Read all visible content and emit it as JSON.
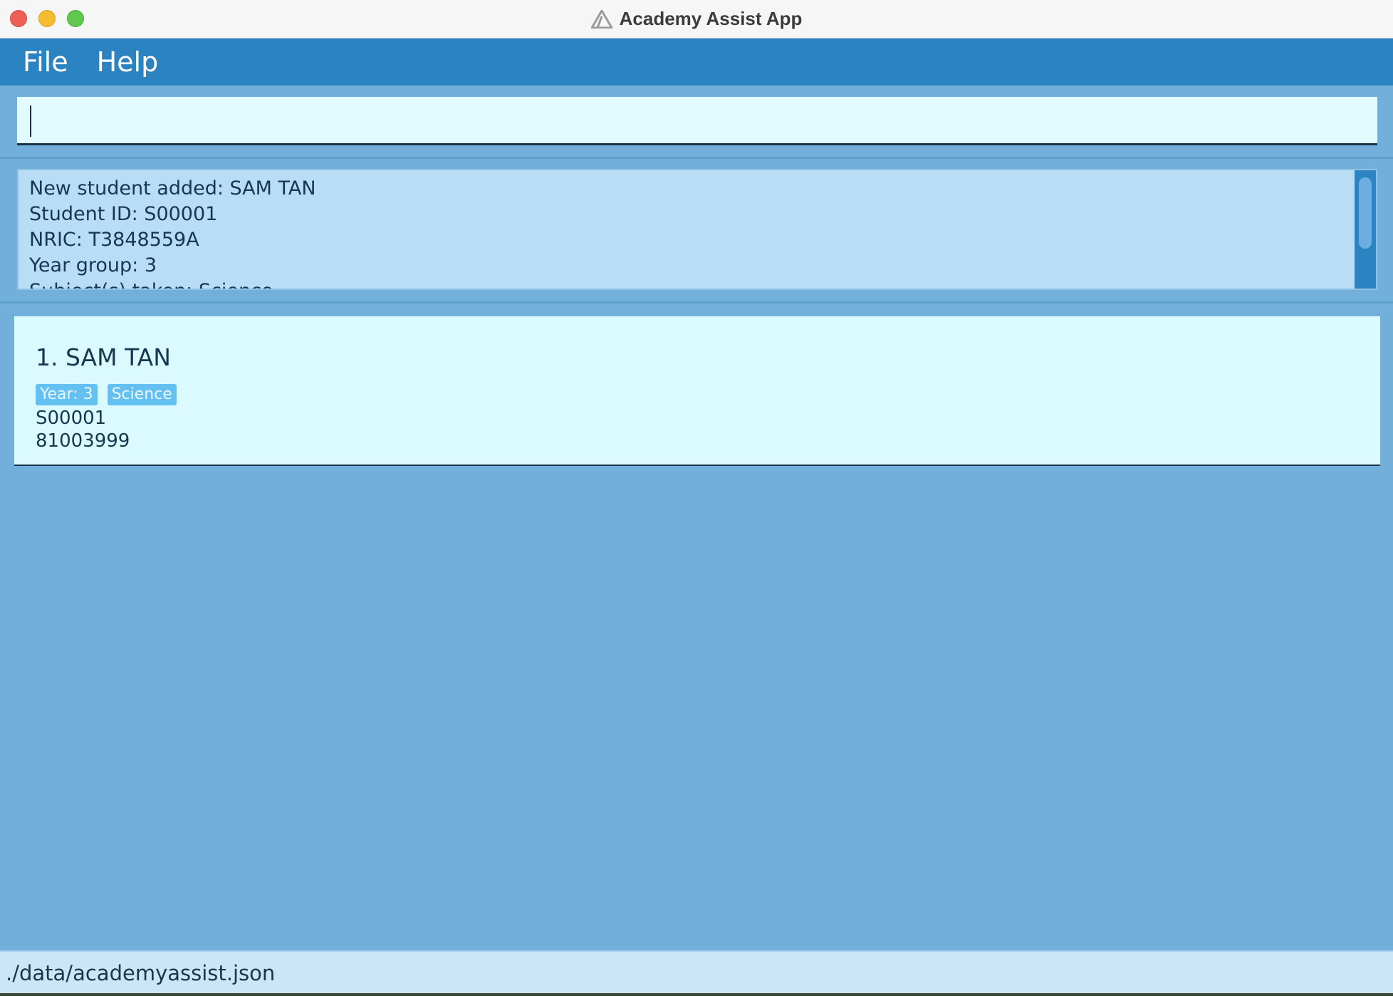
{
  "window": {
    "title": "Academy Assist App"
  },
  "menu": {
    "items": [
      "File",
      "Help"
    ]
  },
  "command_box": {
    "value": ""
  },
  "result_display": {
    "lines": [
      "New student added: SAM TAN",
      "Student ID: S00001",
      "NRIC: T3848559A",
      "Year group: 3",
      "Subject(s) taken: Science"
    ]
  },
  "students": [
    {
      "name": "1. SAM TAN",
      "tags": [
        "Year: 3",
        "Science"
      ],
      "id": "S00001",
      "phone": "81003999"
    }
  ],
  "status_bar": {
    "path": "./data/academyassist.json"
  },
  "colors": {
    "menu_bar": "#2b84c1",
    "background": "#73afdb",
    "command_input": "#e2fbff",
    "result_box": "#b8ddf5",
    "card": "#dbfaff",
    "tag": "#63c0f0"
  }
}
